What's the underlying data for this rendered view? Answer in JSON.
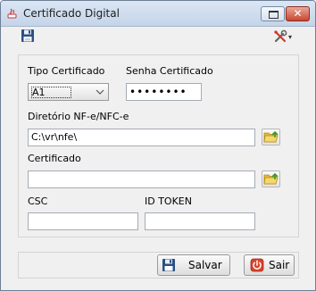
{
  "window": {
    "title": "Certificado Digital",
    "controls": {
      "maximize": "restore-icon",
      "close": "✕"
    }
  },
  "toolbar": {
    "save_icon": "floppy-disk-icon",
    "tools_icon": "tools-icon",
    "tools_caret": "▾"
  },
  "form": {
    "tipo_certificado": {
      "label": "Tipo Certificado",
      "value": "A1"
    },
    "senha_certificado": {
      "label": "Senha Certificado",
      "value": "••••••••"
    },
    "diretorio": {
      "label": "Diretório NF-e/NFC-e",
      "value": "C:\\vr\\nfe\\"
    },
    "certificado": {
      "label": "Certificado",
      "value": ""
    },
    "csc": {
      "label": "CSC",
      "value": ""
    },
    "id_token": {
      "label": "ID TOKEN",
      "value": ""
    }
  },
  "buttons": {
    "salvar": "Salvar",
    "sair": "Sair"
  },
  "colors": {
    "title_gradient_top": "#dbe6f4",
    "close_red": "#c9452f",
    "folder_yellow": "#f2c94c",
    "folder_arrow_green": "#3d9a2a",
    "exit_red": "#d8432c"
  }
}
